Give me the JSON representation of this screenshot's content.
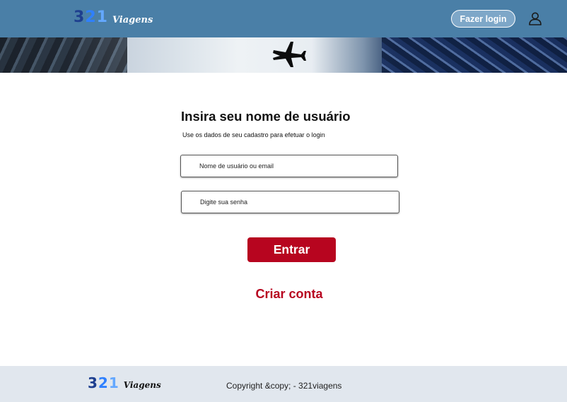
{
  "header": {
    "logo_digits": [
      "3",
      "2",
      "1"
    ],
    "logo_word": "Viagens",
    "login_label": "Fazer login",
    "icons": {
      "profile": "user-icon",
      "banner": "airplane-icon"
    }
  },
  "form": {
    "title": "Insira seu nome de usuário",
    "subtitle": "Use os dados de seu cadastro para efetuar o login",
    "username_placeholder": "Nome de usuário ou email",
    "password_placeholder": "Digite sua senha",
    "submit_label": "Entrar",
    "create_account_label": "Criar conta"
  },
  "footer": {
    "logo_digits": [
      "3",
      "2",
      "1"
    ],
    "logo_word": "Viagens",
    "copyright": "Copyright &copy; - 321viagens"
  },
  "colors": {
    "header_bg": "#4a7fa7",
    "accent_red": "#b7051f",
    "footer_bg": "#e1e7ee",
    "logo_dark_blue": "#1e3f8f",
    "logo_blue": "#2f80ff",
    "logo_light_blue": "#64a8ff"
  }
}
